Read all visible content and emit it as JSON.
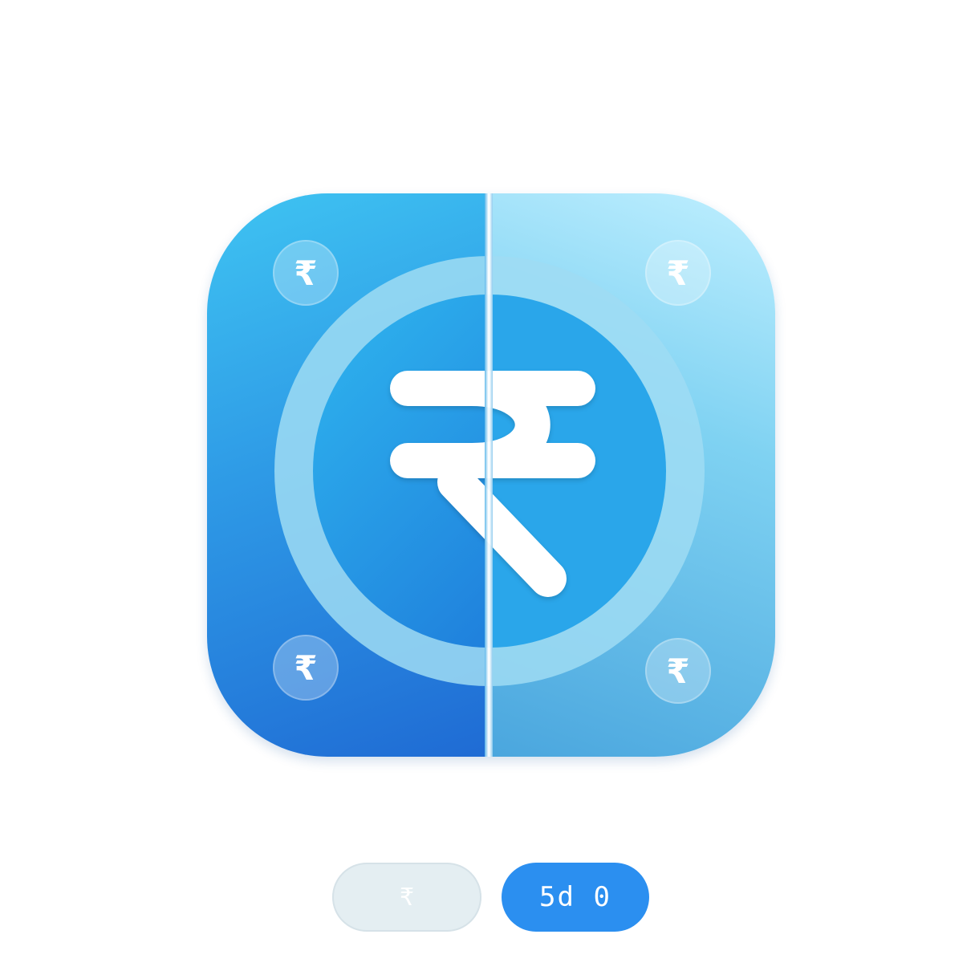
{
  "icon": {
    "center_symbol": "₹",
    "corner_symbol": "₹"
  },
  "buttons": {
    "left_pill_label": "₹",
    "right_pill_label": "5d 0"
  },
  "colors": {
    "left_dark_blue": "#1f6bd4",
    "left_light_blue": "#3fc4f2",
    "right_light_blue": "#bfefff",
    "ring": "#8fd4f0",
    "pill_light": "#e4eef2",
    "pill_blue": "#2b8ff0"
  }
}
